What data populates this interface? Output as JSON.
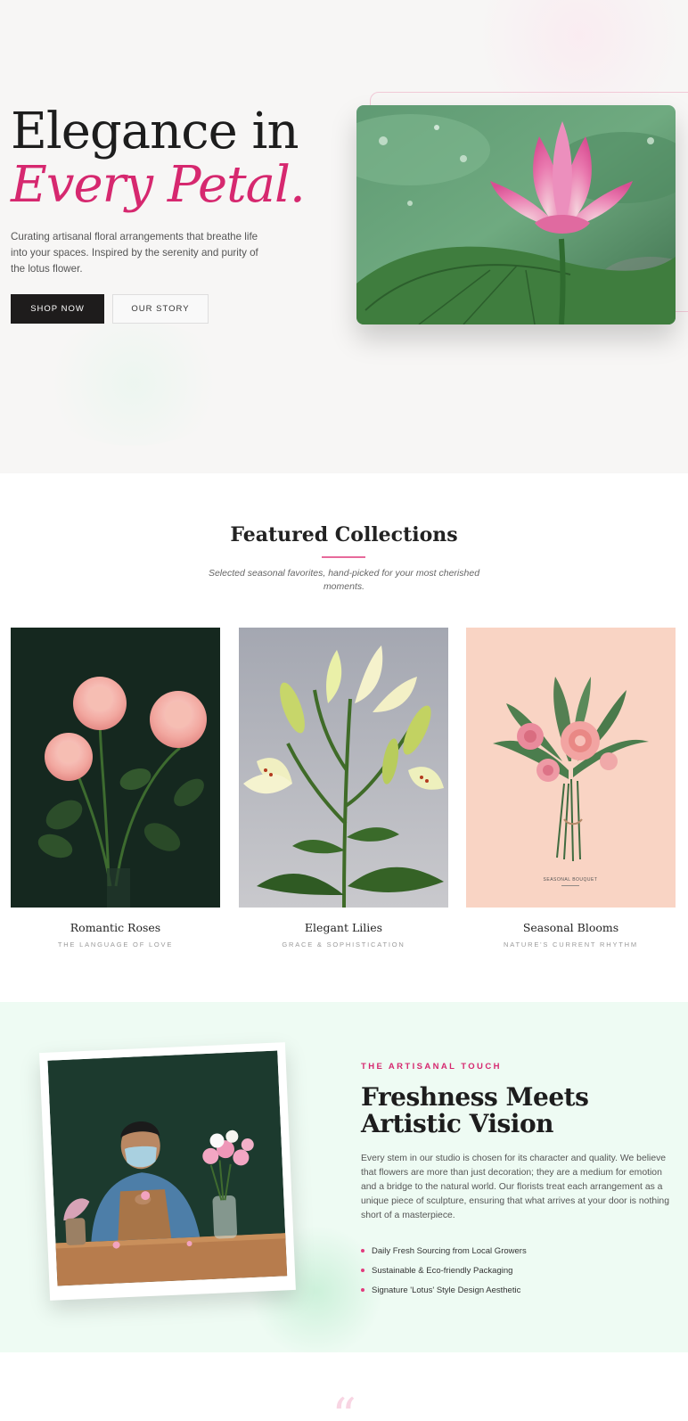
{
  "hero": {
    "title_line1": "Elegance in",
    "title_line2": "Every Petal.",
    "description": "Curating artisanal floral arrangements that breathe life into your spaces. Inspired by the serenity and purity of the lotus flower.",
    "primary_button": "SHOP NOW",
    "secondary_button": "OUR STORY",
    "image": "lotus-flower-photo"
  },
  "featured": {
    "title": "Featured Collections",
    "subtitle": "Selected seasonal favorites, hand-picked for your most cherished moments.",
    "cards": [
      {
        "title": "Romantic Roses",
        "tagline": "THE LANGUAGE OF LOVE",
        "image": "pink-roses-photo"
      },
      {
        "title": "Elegant Lilies",
        "tagline": "GRACE & SOPHISTICATION",
        "image": "white-lilies-photo"
      },
      {
        "title": "Seasonal Blooms",
        "tagline": "NATURE'S CURRENT RHYTHM",
        "image": "seasonal-bouquet-illustration",
        "print_label": "SEASONAL BOUQUET"
      }
    ]
  },
  "artisan": {
    "eyebrow": "THE ARTISANAL TOUCH",
    "title_line1": "Freshness Meets",
    "title_line2": "Artistic Vision",
    "body": "Every stem in our studio is chosen for its character and quality. We believe that flowers are more than just decoration; they are a medium for emotion and a bridge to the natural world. Our florists treat each arrangement as a unique piece of sculpture, ensuring that what arrives at your door is nothing short of a masterpiece.",
    "bullets": [
      "Daily Fresh Sourcing from Local Growers",
      "Sustainable & Eco-friendly Packaging",
      "Signature 'Lotus' Style Design Aesthetic"
    ],
    "image": "florist-arranging-flowers-photo"
  },
  "testimonial": {
    "quote_mark": "“"
  },
  "colors": {
    "accent": "#d6286f",
    "dark": "#1e1c1c",
    "mint": "#eefbf3",
    "hero_bg": "#f7f6f5"
  }
}
